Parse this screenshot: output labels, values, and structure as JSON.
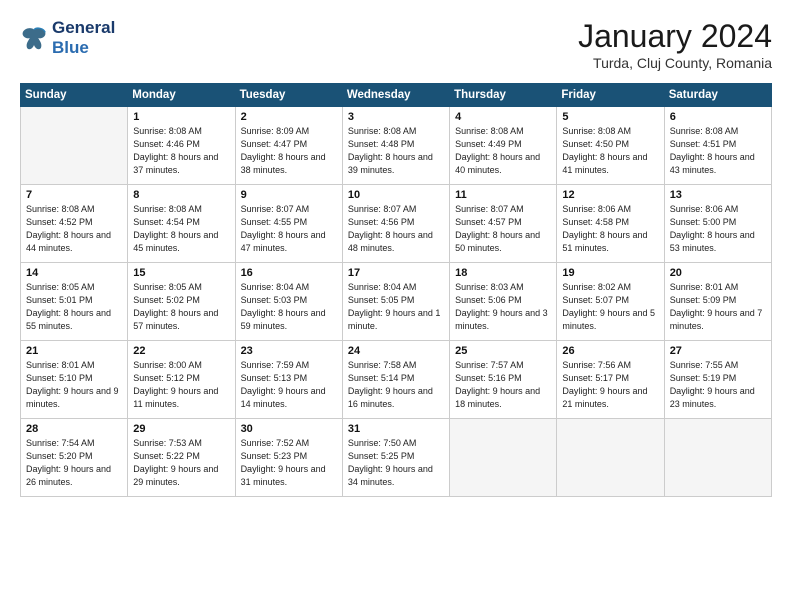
{
  "header": {
    "logo_line1": "General",
    "logo_line2": "Blue",
    "month_title": "January 2024",
    "subtitle": "Turda, Cluj County, Romania"
  },
  "weekdays": [
    "Sunday",
    "Monday",
    "Tuesday",
    "Wednesday",
    "Thursday",
    "Friday",
    "Saturday"
  ],
  "weeks": [
    [
      {
        "day": "",
        "empty": true
      },
      {
        "day": "1",
        "sunrise": "8:08 AM",
        "sunset": "4:46 PM",
        "daylight": "8 hours and 37 minutes."
      },
      {
        "day": "2",
        "sunrise": "8:09 AM",
        "sunset": "4:47 PM",
        "daylight": "8 hours and 38 minutes."
      },
      {
        "day": "3",
        "sunrise": "8:08 AM",
        "sunset": "4:48 PM",
        "daylight": "8 hours and 39 minutes."
      },
      {
        "day": "4",
        "sunrise": "8:08 AM",
        "sunset": "4:49 PM",
        "daylight": "8 hours and 40 minutes."
      },
      {
        "day": "5",
        "sunrise": "8:08 AM",
        "sunset": "4:50 PM",
        "daylight": "8 hours and 41 minutes."
      },
      {
        "day": "6",
        "sunrise": "8:08 AM",
        "sunset": "4:51 PM",
        "daylight": "8 hours and 43 minutes."
      }
    ],
    [
      {
        "day": "7",
        "sunrise": "8:08 AM",
        "sunset": "4:52 PM",
        "daylight": "8 hours and 44 minutes."
      },
      {
        "day": "8",
        "sunrise": "8:08 AM",
        "sunset": "4:54 PM",
        "daylight": "8 hours and 45 minutes."
      },
      {
        "day": "9",
        "sunrise": "8:07 AM",
        "sunset": "4:55 PM",
        "daylight": "8 hours and 47 minutes."
      },
      {
        "day": "10",
        "sunrise": "8:07 AM",
        "sunset": "4:56 PM",
        "daylight": "8 hours and 48 minutes."
      },
      {
        "day": "11",
        "sunrise": "8:07 AM",
        "sunset": "4:57 PM",
        "daylight": "8 hours and 50 minutes."
      },
      {
        "day": "12",
        "sunrise": "8:06 AM",
        "sunset": "4:58 PM",
        "daylight": "8 hours and 51 minutes."
      },
      {
        "day": "13",
        "sunrise": "8:06 AM",
        "sunset": "5:00 PM",
        "daylight": "8 hours and 53 minutes."
      }
    ],
    [
      {
        "day": "14",
        "sunrise": "8:05 AM",
        "sunset": "5:01 PM",
        "daylight": "8 hours and 55 minutes."
      },
      {
        "day": "15",
        "sunrise": "8:05 AM",
        "sunset": "5:02 PM",
        "daylight": "8 hours and 57 minutes."
      },
      {
        "day": "16",
        "sunrise": "8:04 AM",
        "sunset": "5:03 PM",
        "daylight": "8 hours and 59 minutes."
      },
      {
        "day": "17",
        "sunrise": "8:04 AM",
        "sunset": "5:05 PM",
        "daylight": "9 hours and 1 minute."
      },
      {
        "day": "18",
        "sunrise": "8:03 AM",
        "sunset": "5:06 PM",
        "daylight": "9 hours and 3 minutes."
      },
      {
        "day": "19",
        "sunrise": "8:02 AM",
        "sunset": "5:07 PM",
        "daylight": "9 hours and 5 minutes."
      },
      {
        "day": "20",
        "sunrise": "8:01 AM",
        "sunset": "5:09 PM",
        "daylight": "9 hours and 7 minutes."
      }
    ],
    [
      {
        "day": "21",
        "sunrise": "8:01 AM",
        "sunset": "5:10 PM",
        "daylight": "9 hours and 9 minutes."
      },
      {
        "day": "22",
        "sunrise": "8:00 AM",
        "sunset": "5:12 PM",
        "daylight": "9 hours and 11 minutes."
      },
      {
        "day": "23",
        "sunrise": "7:59 AM",
        "sunset": "5:13 PM",
        "daylight": "9 hours and 14 minutes."
      },
      {
        "day": "24",
        "sunrise": "7:58 AM",
        "sunset": "5:14 PM",
        "daylight": "9 hours and 16 minutes."
      },
      {
        "day": "25",
        "sunrise": "7:57 AM",
        "sunset": "5:16 PM",
        "daylight": "9 hours and 18 minutes."
      },
      {
        "day": "26",
        "sunrise": "7:56 AM",
        "sunset": "5:17 PM",
        "daylight": "9 hours and 21 minutes."
      },
      {
        "day": "27",
        "sunrise": "7:55 AM",
        "sunset": "5:19 PM",
        "daylight": "9 hours and 23 minutes."
      }
    ],
    [
      {
        "day": "28",
        "sunrise": "7:54 AM",
        "sunset": "5:20 PM",
        "daylight": "9 hours and 26 minutes."
      },
      {
        "day": "29",
        "sunrise": "7:53 AM",
        "sunset": "5:22 PM",
        "daylight": "9 hours and 29 minutes."
      },
      {
        "day": "30",
        "sunrise": "7:52 AM",
        "sunset": "5:23 PM",
        "daylight": "9 hours and 31 minutes."
      },
      {
        "day": "31",
        "sunrise": "7:50 AM",
        "sunset": "5:25 PM",
        "daylight": "9 hours and 34 minutes."
      },
      {
        "day": "",
        "empty": true
      },
      {
        "day": "",
        "empty": true
      },
      {
        "day": "",
        "empty": true
      }
    ]
  ]
}
